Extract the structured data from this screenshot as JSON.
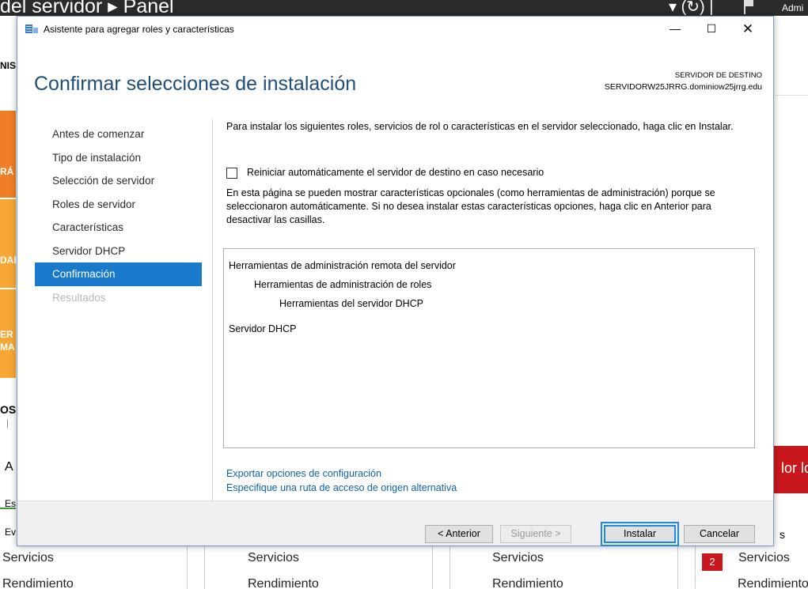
{
  "background": {
    "title": "del servidor ▸ Panel",
    "refresh_glyph": "▾ (↻) |",
    "admin_text": "Admi",
    "left_fragments": [
      "NIS",
      "RÁ",
      "DAD",
      "ER",
      "MA",
      "OS",
      "|",
      "A",
      "Es",
      "Ev",
      "Servicios",
      "Rendimiento"
    ],
    "right_red_text": "lor lo",
    "right_fragment": "s",
    "badge": "2",
    "bottom_services": "Servicios",
    "bottom_performance": "Rendimiento",
    "bottom_right_services": "Servicios",
    "bottom_right_performance": "Rendimiento"
  },
  "dialog": {
    "window_title": "Asistente para agregar roles y características",
    "icon": "server-wizard-icon",
    "controls": {
      "minimize": "—",
      "maximize": "☐",
      "close": "✕"
    },
    "page_title": "Confirmar selecciones de instalación",
    "destination_label": "SERVIDOR DE DESTINO",
    "destination_server": "SERVIDORW25JRRG.dominiow25jrrg.edu",
    "nav": [
      {
        "label": "Antes de comenzar",
        "state": "normal"
      },
      {
        "label": "Tipo de instalación",
        "state": "normal"
      },
      {
        "label": "Selección de servidor",
        "state": "normal"
      },
      {
        "label": "Roles de servidor",
        "state": "normal"
      },
      {
        "label": "Características",
        "state": "normal"
      },
      {
        "label": "Servidor DHCP",
        "state": "normal"
      },
      {
        "label": "Confirmación",
        "state": "active"
      },
      {
        "label": "Resultados",
        "state": "disabled"
      }
    ],
    "intro_text": "Para instalar los siguientes roles, servicios de rol o características en el servidor seleccionado, haga clic en Instalar.",
    "restart_checkbox_label": "Reiniciar automáticamente el servidor de destino en caso necesario",
    "restart_checked": false,
    "optional_text": "En esta página se pueden mostrar características opcionales (como herramientas de administración) porque se seleccionaron automáticamente. Si no desea instalar estas características opciones, haga clic en Anterior para desactivar las casillas.",
    "selections": [
      "Herramientas de administración remota del servidor",
      "Herramientas de administración de roles",
      "Herramientas del servidor DHCP",
      "Servidor DHCP"
    ],
    "export_link": "Exportar opciones de configuración",
    "alt_source_link": "Especifique una ruta de acceso de origen alternativa",
    "buttons": {
      "previous": "< Anterior",
      "next": "Siguiente >",
      "install": "Instalar",
      "cancel": "Cancelar"
    },
    "accent_color": "#1979ca",
    "title_color": "#1e4e79",
    "link_color": "#0e63a8"
  }
}
